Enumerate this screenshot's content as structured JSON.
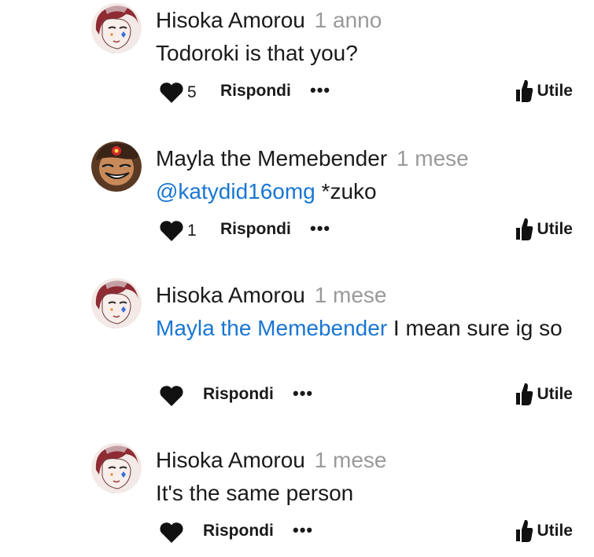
{
  "comments": [
    {
      "author": "Hisoka Amorou",
      "time": "1 anno",
      "mention": "",
      "text": "Todoroki is that you?",
      "likes": "5",
      "reply_label": "Rispondi",
      "more_label": "•••",
      "useful_label": "Utile",
      "avatar": "red-haired-anime-avatar"
    },
    {
      "author": "Mayla the Memebender",
      "time": "1 mese",
      "mention": "@katydid16omg",
      "text": " *zuko",
      "likes": "1",
      "reply_label": "Rispondi",
      "more_label": "•••",
      "useful_label": "Utile",
      "avatar": "smiling-cartoon-avatar"
    },
    {
      "author": "Hisoka Amorou",
      "time": "1 mese",
      "mention": "Mayla the Memebender",
      "text": " I mean sure ig so",
      "likes": "",
      "reply_label": "Rispondi",
      "more_label": "•••",
      "useful_label": "Utile",
      "avatar": "red-haired-anime-avatar"
    },
    {
      "author": "Hisoka Amorou",
      "time": "1 mese",
      "mention": "",
      "text": "It's the same person",
      "likes": "",
      "reply_label": "Rispondi",
      "more_label": "•••",
      "useful_label": "Utile",
      "avatar": "red-haired-anime-avatar"
    }
  ],
  "colors": {
    "mention": "#1976d2",
    "time": "#9a9a9a",
    "text": "#1a1a1a"
  }
}
